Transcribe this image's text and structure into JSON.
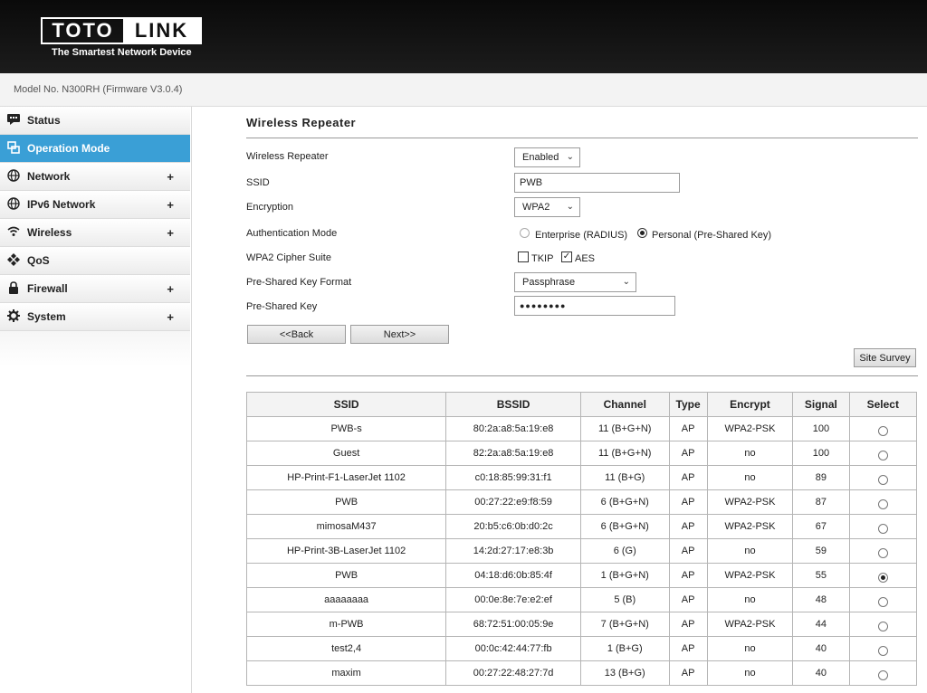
{
  "header": {
    "logo_left": "TOTO",
    "logo_right": "LINK",
    "tagline": "The Smartest Network Device",
    "model": "Model No. N300RH (Firmware V3.0.4)"
  },
  "sidebar": {
    "items": [
      {
        "label": "Status",
        "icon": "status-icon",
        "plus": ""
      },
      {
        "label": "Operation Mode",
        "icon": "operation-mode-icon",
        "plus": ""
      },
      {
        "label": "Network",
        "icon": "globe-icon",
        "plus": "+"
      },
      {
        "label": "IPv6 Network",
        "icon": "globe-icon",
        "plus": "+"
      },
      {
        "label": "Wireless",
        "icon": "wifi-icon",
        "plus": "+"
      },
      {
        "label": "QoS",
        "icon": "qos-icon",
        "plus": ""
      },
      {
        "label": "Firewall",
        "icon": "lock-icon",
        "plus": "+"
      },
      {
        "label": "System",
        "icon": "gear-icon",
        "plus": "+"
      }
    ],
    "active_index": 1,
    "active_color": "#3a9fd6"
  },
  "main": {
    "title": "Wireless Repeater",
    "form": {
      "repeater_label": "Wireless Repeater",
      "repeater_value": "Enabled",
      "ssid_label": "SSID",
      "ssid_value": "PWB",
      "encryption_label": "Encryption",
      "encryption_value": "WPA2",
      "auth_label": "Authentication Mode",
      "auth_enterprise": "Enterprise (RADIUS)",
      "auth_personal": "Personal (Pre-Shared Key)",
      "cipher_label": "WPA2 Cipher Suite",
      "cipher_tkip": "TKIP",
      "cipher_aes": "AES",
      "psk_format_label": "Pre-Shared Key Format",
      "psk_format_value": "Passphrase",
      "psk_label": "Pre-Shared Key",
      "psk_value": "●●●●●●●●"
    },
    "buttons": {
      "back": "<<Back",
      "next": "Next>>",
      "site_survey": "Site Survey"
    },
    "table": {
      "headers": [
        "SSID",
        "BSSID",
        "Channel",
        "Type",
        "Encrypt",
        "Signal",
        "Select"
      ],
      "rows": [
        {
          "ssid": "PWB-s",
          "bssid": "80:2a:a8:5a:19:e8",
          "channel": "11 (B+G+N)",
          "type": "AP",
          "encrypt": "WPA2-PSK",
          "signal": "100",
          "selected": false
        },
        {
          "ssid": "Guest",
          "bssid": "82:2a:a8:5a:19:e8",
          "channel": "11 (B+G+N)",
          "type": "AP",
          "encrypt": "no",
          "signal": "100",
          "selected": false
        },
        {
          "ssid": "HP-Print-F1-LaserJet 1102",
          "bssid": "c0:18:85:99:31:f1",
          "channel": "11 (B+G)",
          "type": "AP",
          "encrypt": "no",
          "signal": "89",
          "selected": false
        },
        {
          "ssid": "PWB",
          "bssid": "00:27:22:e9:f8:59",
          "channel": "6 (B+G+N)",
          "type": "AP",
          "encrypt": "WPA2-PSK",
          "signal": "87",
          "selected": false
        },
        {
          "ssid": "mimosaM437",
          "bssid": "20:b5:c6:0b:d0:2c",
          "channel": "6 (B+G+N)",
          "type": "AP",
          "encrypt": "WPA2-PSK",
          "signal": "67",
          "selected": false
        },
        {
          "ssid": "HP-Print-3B-LaserJet 1102",
          "bssid": "14:2d:27:17:e8:3b",
          "channel": "6 (G)",
          "type": "AP",
          "encrypt": "no",
          "signal": "59",
          "selected": false
        },
        {
          "ssid": "PWB",
          "bssid": "04:18:d6:0b:85:4f",
          "channel": "1 (B+G+N)",
          "type": "AP",
          "encrypt": "WPA2-PSK",
          "signal": "55",
          "selected": true
        },
        {
          "ssid": "aaaaaaaa",
          "bssid": "00:0e:8e:7e:e2:ef",
          "channel": "5 (B)",
          "type": "AP",
          "encrypt": "no",
          "signal": "48",
          "selected": false
        },
        {
          "ssid": "m-PWB",
          "bssid": "68:72:51:00:05:9e",
          "channel": "7 (B+G+N)",
          "type": "AP",
          "encrypt": "WPA2-PSK",
          "signal": "44",
          "selected": false
        },
        {
          "ssid": "test2,4",
          "bssid": "00:0c:42:44:77:fb",
          "channel": "1 (B+G)",
          "type": "AP",
          "encrypt": "no",
          "signal": "40",
          "selected": false
        },
        {
          "ssid": "maxim",
          "bssid": "00:27:22:48:27:7d",
          "channel": "13 (B+G)",
          "type": "AP",
          "encrypt": "no",
          "signal": "40",
          "selected": false
        }
      ]
    }
  }
}
